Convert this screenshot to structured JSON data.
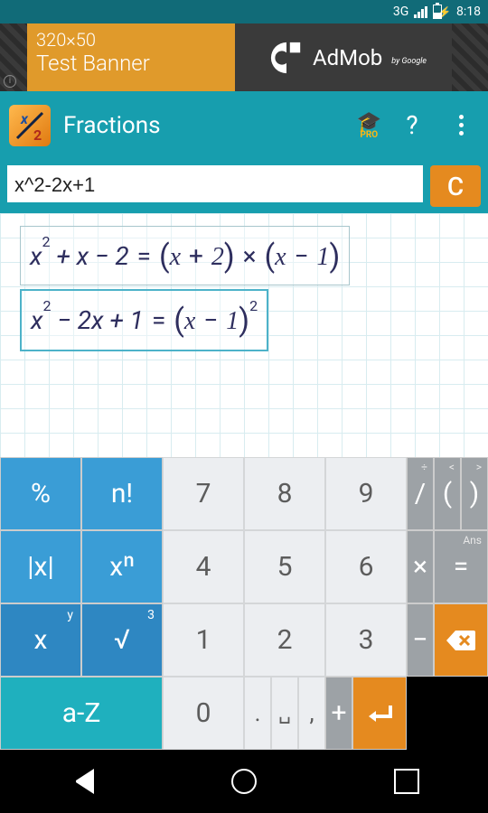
{
  "status": {
    "network": "3G",
    "time": "8:18"
  },
  "ad": {
    "dimensions": "320×50",
    "label": "Test Banner",
    "brand": "AdMob",
    "byline": "by Google"
  },
  "appbar": {
    "title": "Fractions",
    "pro_label": "PRO",
    "help_label": "?"
  },
  "input": {
    "value": "x^2-2x+1",
    "clear_label": "C"
  },
  "results": [
    {
      "lhs_var": "x",
      "lhs_exp": "2",
      "lhs_rest": " + x − 2",
      "rhs": "(x + 2) × (x − 1)",
      "rhs_exp": "",
      "active": false
    },
    {
      "lhs_var": "x",
      "lhs_exp": "2",
      "lhs_rest": " − 2x + 1",
      "rhs": "(x − 1)",
      "rhs_exp": "2",
      "active": true
    }
  ],
  "keys": {
    "r1": [
      "%",
      "n!",
      "7",
      "8",
      "9",
      "/",
      "(",
      ")"
    ],
    "r1_sup": [
      "",
      "",
      "",
      "",
      "",
      "÷",
      "<",
      ">"
    ],
    "r2": [
      "|x|",
      "xⁿ",
      "4",
      "5",
      "6",
      "×",
      "="
    ],
    "r2_sup": [
      "",
      "",
      "",
      "",
      "",
      "",
      "Ans"
    ],
    "r3_x": "x",
    "r3_x_sup": "y",
    "r3_sqrt": "√",
    "r3_sqrt_sup": "3",
    "r3": [
      "1",
      "2",
      "3",
      "−"
    ],
    "r4": [
      "a-Z",
      "0",
      ".",
      "␣",
      ",",
      "+"
    ]
  }
}
